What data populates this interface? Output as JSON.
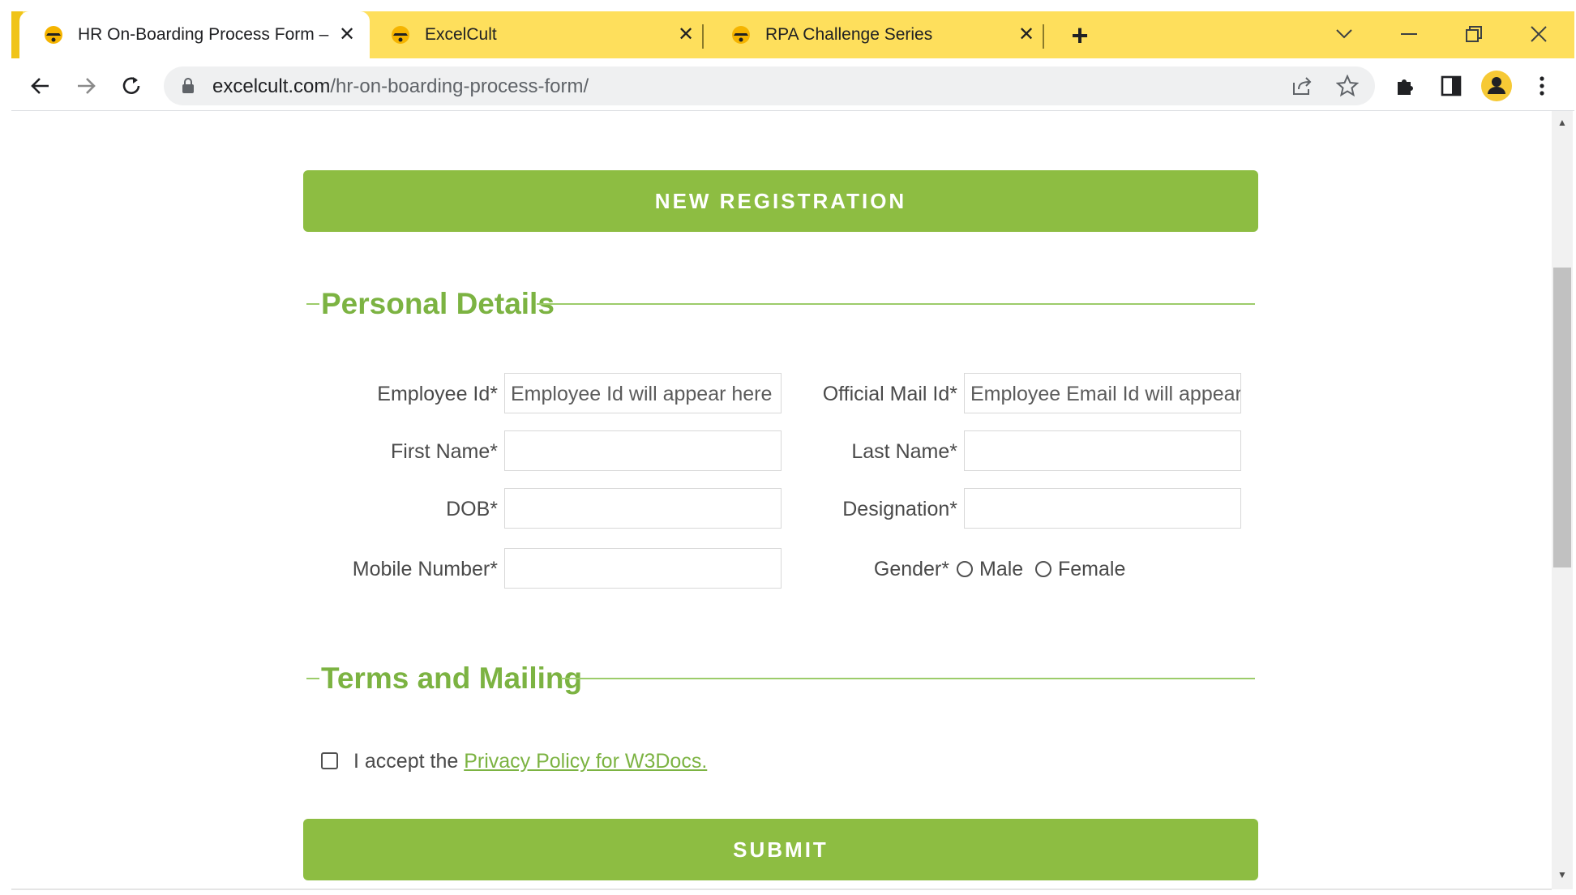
{
  "browser": {
    "tabs": [
      {
        "title": "HR On-Boarding Process Form –",
        "active": true
      },
      {
        "title": "ExcelCult",
        "active": false
      },
      {
        "title": "RPA Challenge Series",
        "active": false
      }
    ],
    "new_tab_label": "+",
    "url_host": "excelcult.com",
    "url_path": "/hr-on-boarding-process-form/"
  },
  "form": {
    "new_registration_label": "NEW REGISTRATION",
    "personal_details_title": "Personal Details",
    "fields": {
      "employee_id_label": "Employee Id*",
      "employee_id_placeholder": "Employee Id will appear here",
      "official_mail_label": "Official Mail Id*",
      "official_mail_placeholder": "Employee Email Id will appear",
      "first_name_label": "First Name*",
      "last_name_label": "Last Name*",
      "dob_label": "DOB*",
      "designation_label": "Designation*",
      "mobile_label": "Mobile Number*",
      "gender_label": "Gender*",
      "gender_options": [
        "Male",
        "Female"
      ]
    },
    "terms_title": "Terms and Mailing",
    "accept_prefix": "I accept the",
    "privacy_link": "Privacy Policy for W3Docs.",
    "submit_label": "SUBMIT"
  },
  "colors": {
    "accent_green": "#8dbd42",
    "tab_strip": "#fedf5c"
  }
}
